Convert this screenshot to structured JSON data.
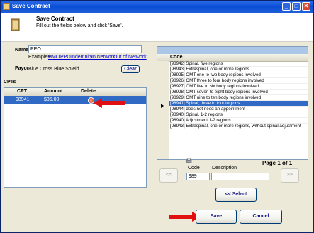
{
  "window": {
    "title": "Save Contract"
  },
  "header": {
    "title": "Save Contract",
    "subtitle": "Fill out the fields below and click 'Save'."
  },
  "form": {
    "name_label": "Name",
    "name_value": "PPO",
    "examples_label": "Examples:",
    "examples": [
      "HMO",
      "PPO",
      "Indemnity",
      "In Network",
      "Out of Network"
    ],
    "payor_label": "Payor",
    "payor_value": "Blue Cross Blue Shield",
    "clear_label": "Clear"
  },
  "cpts": {
    "label": "CPTs",
    "columns": [
      "CPT",
      "Amount",
      "Delete"
    ],
    "rows": [
      {
        "cpt": "98941",
        "amount": "$35.00"
      }
    ]
  },
  "codes": {
    "column": "Code",
    "rows": [
      "[98942] Spinal, five regions",
      "[98943] Extraspinal, one or more regions",
      "[98925] OMT one to two body regions involved",
      "[98926] OMT three to four body regions involved",
      "[98927] OMT five to six body regions involved",
      "[98928] OMT seven to eight body regions involved",
      "[98929] OMT nine to ten body regions involved",
      "[98941] Spinal, three to four regions",
      "[98944] does not need an appointment",
      "[98940] Spinal, 1-2 regions",
      "[98940] Adjustment 1-2 regions",
      "[98943] Extraspinal, one or more regions, without spinal adjustment"
    ],
    "selected_index": 7
  },
  "pager": {
    "page_text": "Page 1 of 1",
    "prev_label": "<<",
    "next_label": ">>",
    "code_label": "Code",
    "description_label": "Description",
    "code_value": "989",
    "description_value": ""
  },
  "buttons": {
    "select_label": "<< Select",
    "save_label": "Save",
    "cancel_label": "Cancel"
  }
}
